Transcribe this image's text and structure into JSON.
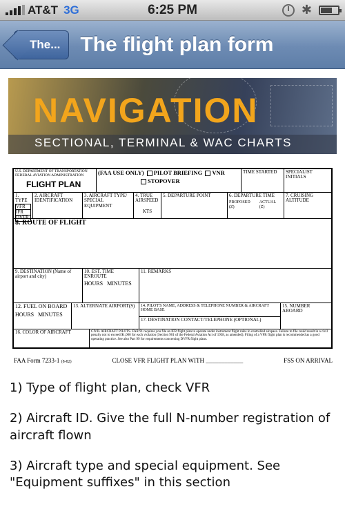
{
  "status": {
    "carrier": "AT&T",
    "network": "3G",
    "time": "6:25 PM"
  },
  "nav": {
    "back_label": "The...",
    "title": "The flight plan form"
  },
  "banner": {
    "title": "NAVIGATION",
    "subtitle": "SECTIONAL, TERMINAL & WAC CHARTS"
  },
  "form": {
    "agency": "U.S. DEPARTMENT OF TRANSPORTATION FEDERAL AVIATION ADMINISTRATION",
    "heading": "FLIGHT PLAN",
    "faa_use": "(FAA USE ONLY)",
    "pilot_briefing": "PILOT BRIEFING",
    "vnr": "VNR",
    "stopover": "STOPOVER",
    "time_started": "TIME STARTED",
    "specialist": "SPECIALIST INITIALS",
    "f1": "1. TYPE",
    "f1_vfr": "VFR",
    "f1_ifr": "IFR",
    "f1_dvfr": "DVFR",
    "f2": "2. AIRCRAFT IDENTIFICATION",
    "f3": "3. AIRCRAFT TYPE/ SPECIAL EQUIPMENT",
    "f4": "4. TRUE AIRSPEED",
    "f4_unit": "KTS",
    "f5": "5. DEPARTURE POINT",
    "f6": "6. DEPARTURE TIME",
    "f6_proposed": "PROPOSED (Z)",
    "f6_actual": "ACTUAL (Z)",
    "f7": "7. CRUISING ALTITUDE",
    "f8": "8. ROUTE OF FLIGHT",
    "f9": "9. DESTINATION (Name of airport and city)",
    "f10": "10. EST. TIME ENROUTE",
    "f10_hours": "HOURS",
    "f10_minutes": "MINUTES",
    "f11": "11. REMARKS",
    "f12": "12. FUEL ON BOARD",
    "f12_hours": "HOURS",
    "f12_minutes": "MINUTES",
    "f13": "13. ALTERNATE AIRPORT(S)",
    "f14": "14. PILOT'S NAME, ADDRESS & TELEPHONE NUMBER & AIRCRAFT HOME BASE",
    "f15": "15. NUMBER ABOARD",
    "f16": "16. COLOR OF AIRCRAFT",
    "f17": "17. DESTINATION CONTACT/TELEPHONE (OPTIONAL)",
    "civil_notice": "CIVIL AIRCRAFT PILOTS. FAR 91 requires you file an IFR flight plan to operate under instrument flight rules in controlled airspace. Failure to file could result in a civil penalty not to exceed $1,000 for each violation (Section 901 of the Federal Aviation Act of 1958, as amended). Filing of a VFR flight plan is recommended as a good operating practice. See also Part 99 for requirements concerning DVFR flight plans.",
    "form_number": "FAA Form 7233-1",
    "form_date": "(8-82)",
    "close_text": "CLOSE VFR FLIGHT PLAN WITH",
    "fss_text": "FSS ON ARRIVAL"
  },
  "notes": [
    "1) Type of flight plan, check VFR",
    "2) Aircraft ID.  Give the full N-number registration of aircraft flown",
    "3) Aircraft type and special equipment.  See \"Equipment suffixes\" in this section"
  ]
}
